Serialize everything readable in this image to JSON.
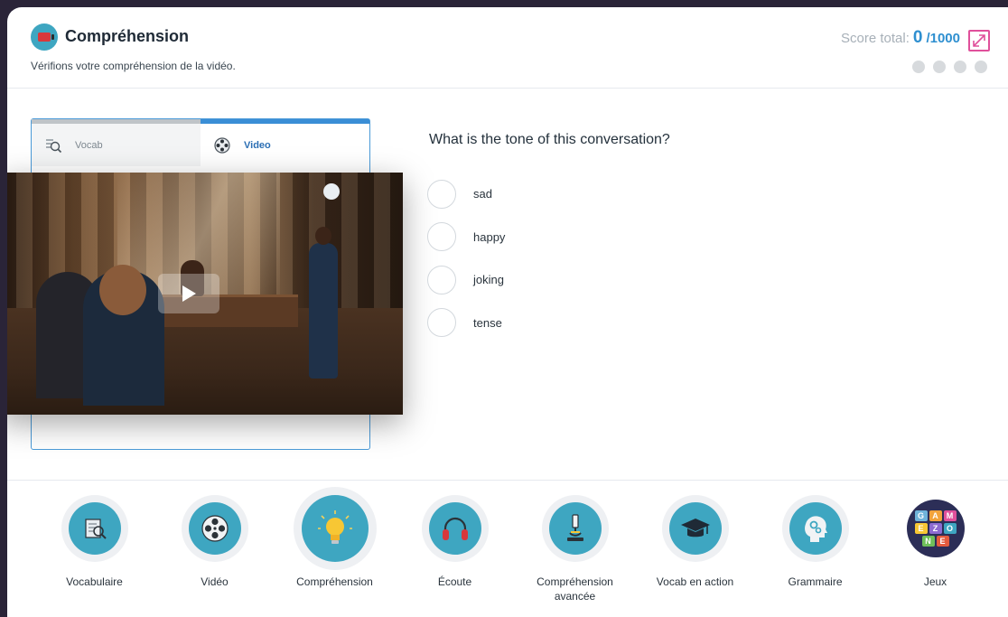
{
  "header": {
    "title": "Compréhension",
    "subtitle": "Vérifions votre compréhension de la vidéo.",
    "score_label": "Score total:",
    "score_value": "0",
    "score_max": "/1000"
  },
  "panel": {
    "tabs": [
      {
        "label": "Vocab",
        "icon": "magnifier-doc-icon"
      },
      {
        "label": "Video",
        "icon": "film-reel-icon",
        "active": true
      }
    ]
  },
  "question": {
    "text": "What is the tone of this conversation?",
    "options": [
      "sad",
      "happy",
      "joking",
      "tense"
    ]
  },
  "nav": {
    "items": [
      {
        "label": "Vocabulaire",
        "icon": "vocabulary-icon"
      },
      {
        "label": "Vidéo",
        "icon": "film-reel-icon"
      },
      {
        "label": "Compréhension",
        "icon": "lightbulb-icon",
        "active": true
      },
      {
        "label": "Écoute",
        "icon": "headphones-icon"
      },
      {
        "label": "Compréhension avancée",
        "icon": "microscope-icon"
      },
      {
        "label": "Vocab en action",
        "icon": "graduation-cap-icon"
      },
      {
        "label": "Grammaire",
        "icon": "brain-gears-icon"
      },
      {
        "label": "Jeux",
        "icon": "game-zone-icon"
      }
    ]
  },
  "game_zone_letters": [
    "G",
    "A",
    "M",
    "E",
    "Z",
    "O",
    "N",
    "E"
  ],
  "colors": {
    "accent_blue": "#2e8fd0",
    "module_teal": "#3ea6c1",
    "expand_pink": "#e0509b"
  }
}
